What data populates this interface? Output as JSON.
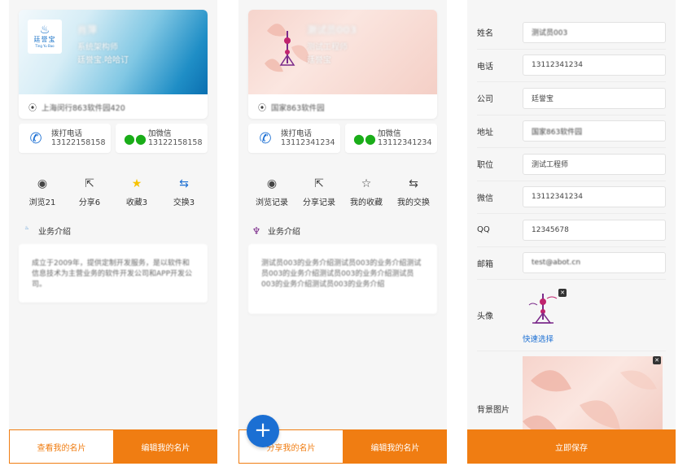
{
  "colors": {
    "accent": "#f07d12",
    "blue": "#1b6fd3",
    "star": "#f7c200",
    "wechat": "#1aad19"
  },
  "panel1": {
    "logo": {
      "cn": "廷誉宝",
      "en": "Ting Yu Bao"
    },
    "name": "肖萍",
    "title": "系统架构师",
    "company": "廷誉宝.哈哈订",
    "address": "上海闵行863软件园420",
    "call": {
      "label": "拨打电话",
      "number": "13122158158"
    },
    "wechat": {
      "label": "加微信",
      "number": "13122158158"
    },
    "stats": [
      {
        "icon": "eye-icon",
        "label": "浏览21"
      },
      {
        "icon": "share-icon",
        "label": "分享6"
      },
      {
        "icon": "star-icon",
        "label": "收藏3"
      },
      {
        "icon": "swap-icon",
        "label": "交换3"
      }
    ],
    "intro_title": "业务介绍",
    "intro_text": "成立于2009年，提供定制开发服务，是以软件和信息技术为主营业务的软件开发公司和APP开发公司。",
    "bottom_left": "查看我的名片",
    "bottom_right": "编辑我的名片"
  },
  "panel2": {
    "name": "测试员003",
    "title": "测试工程师",
    "company": "廷誉宝",
    "address": "国家863软件园",
    "call": {
      "label": "拨打电话",
      "number": "13112341234"
    },
    "wechat": {
      "label": "加微信",
      "number": "13112341234"
    },
    "stats": [
      {
        "icon": "eye-icon",
        "label": "浏览记录"
      },
      {
        "icon": "share-icon",
        "label": "分享记录"
      },
      {
        "icon": "star-outline-icon",
        "label": "我的收藏"
      },
      {
        "icon": "swap-icon",
        "label": "我的交换"
      }
    ],
    "intro_title": "业务介绍",
    "intro_text": "测试员003的业务介绍测试员003的业务介绍测试员003的业务介绍测试员003的业务介绍测试员003的业务介绍测试员003的业务介绍",
    "fab": "+",
    "bottom_left": "分享我的名片",
    "bottom_right": "编辑我的名片"
  },
  "panel3": {
    "fields": [
      {
        "label": "姓名",
        "value": "测试员003"
      },
      {
        "label": "电话",
        "value": "13112341234"
      },
      {
        "label": "公司",
        "value": "廷誉宝"
      },
      {
        "label": "地址",
        "value": "国家863软件园"
      },
      {
        "label": "职位",
        "value": "测试工程师"
      },
      {
        "label": "微信",
        "value": "13112341234"
      },
      {
        "label": "QQ",
        "value": "12345678"
      },
      {
        "label": "邮箱",
        "value": "test@abot.cn"
      }
    ],
    "avatar_label": "头像",
    "quick_pick": "快速选择",
    "bg_label": "背景图片",
    "save": "立即保存",
    "close_glyph": "✕"
  }
}
